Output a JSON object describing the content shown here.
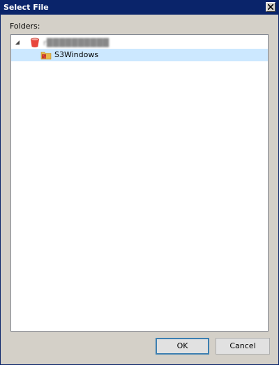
{
  "window": {
    "title": "Select File",
    "close_icon": "close-icon"
  },
  "folders_label": "Folders:",
  "tree": {
    "root": {
      "icon": "bucket-icon",
      "name": "r██████████",
      "expanded": true
    },
    "children": [
      {
        "icon": "folder-icon",
        "label": "S3Windows",
        "selected": true
      }
    ]
  },
  "buttons": {
    "ok": "OK",
    "cancel": "Cancel"
  },
  "colors": {
    "titlebar": "#0a246a",
    "selection": "#cce8ff",
    "bucket": "#e8453c"
  }
}
